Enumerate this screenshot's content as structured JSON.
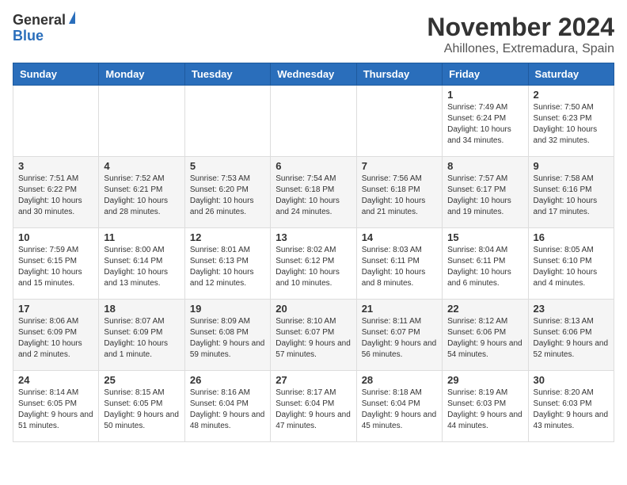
{
  "logo": {
    "general": "General",
    "blue": "Blue"
  },
  "header": {
    "month_title": "November 2024",
    "location": "Ahillones, Extremadura, Spain"
  },
  "weekdays": [
    "Sunday",
    "Monday",
    "Tuesday",
    "Wednesday",
    "Thursday",
    "Friday",
    "Saturday"
  ],
  "weeks": [
    [
      {
        "day": "",
        "info": ""
      },
      {
        "day": "",
        "info": ""
      },
      {
        "day": "",
        "info": ""
      },
      {
        "day": "",
        "info": ""
      },
      {
        "day": "",
        "info": ""
      },
      {
        "day": "1",
        "info": "Sunrise: 7:49 AM\nSunset: 6:24 PM\nDaylight: 10 hours and 34 minutes."
      },
      {
        "day": "2",
        "info": "Sunrise: 7:50 AM\nSunset: 6:23 PM\nDaylight: 10 hours and 32 minutes."
      }
    ],
    [
      {
        "day": "3",
        "info": "Sunrise: 7:51 AM\nSunset: 6:22 PM\nDaylight: 10 hours and 30 minutes."
      },
      {
        "day": "4",
        "info": "Sunrise: 7:52 AM\nSunset: 6:21 PM\nDaylight: 10 hours and 28 minutes."
      },
      {
        "day": "5",
        "info": "Sunrise: 7:53 AM\nSunset: 6:20 PM\nDaylight: 10 hours and 26 minutes."
      },
      {
        "day": "6",
        "info": "Sunrise: 7:54 AM\nSunset: 6:18 PM\nDaylight: 10 hours and 24 minutes."
      },
      {
        "day": "7",
        "info": "Sunrise: 7:56 AM\nSunset: 6:18 PM\nDaylight: 10 hours and 21 minutes."
      },
      {
        "day": "8",
        "info": "Sunrise: 7:57 AM\nSunset: 6:17 PM\nDaylight: 10 hours and 19 minutes."
      },
      {
        "day": "9",
        "info": "Sunrise: 7:58 AM\nSunset: 6:16 PM\nDaylight: 10 hours and 17 minutes."
      }
    ],
    [
      {
        "day": "10",
        "info": "Sunrise: 7:59 AM\nSunset: 6:15 PM\nDaylight: 10 hours and 15 minutes."
      },
      {
        "day": "11",
        "info": "Sunrise: 8:00 AM\nSunset: 6:14 PM\nDaylight: 10 hours and 13 minutes."
      },
      {
        "day": "12",
        "info": "Sunrise: 8:01 AM\nSunset: 6:13 PM\nDaylight: 10 hours and 12 minutes."
      },
      {
        "day": "13",
        "info": "Sunrise: 8:02 AM\nSunset: 6:12 PM\nDaylight: 10 hours and 10 minutes."
      },
      {
        "day": "14",
        "info": "Sunrise: 8:03 AM\nSunset: 6:11 PM\nDaylight: 10 hours and 8 minutes."
      },
      {
        "day": "15",
        "info": "Sunrise: 8:04 AM\nSunset: 6:11 PM\nDaylight: 10 hours and 6 minutes."
      },
      {
        "day": "16",
        "info": "Sunrise: 8:05 AM\nSunset: 6:10 PM\nDaylight: 10 hours and 4 minutes."
      }
    ],
    [
      {
        "day": "17",
        "info": "Sunrise: 8:06 AM\nSunset: 6:09 PM\nDaylight: 10 hours and 2 minutes."
      },
      {
        "day": "18",
        "info": "Sunrise: 8:07 AM\nSunset: 6:09 PM\nDaylight: 10 hours and 1 minute."
      },
      {
        "day": "19",
        "info": "Sunrise: 8:09 AM\nSunset: 6:08 PM\nDaylight: 9 hours and 59 minutes."
      },
      {
        "day": "20",
        "info": "Sunrise: 8:10 AM\nSunset: 6:07 PM\nDaylight: 9 hours and 57 minutes."
      },
      {
        "day": "21",
        "info": "Sunrise: 8:11 AM\nSunset: 6:07 PM\nDaylight: 9 hours and 56 minutes."
      },
      {
        "day": "22",
        "info": "Sunrise: 8:12 AM\nSunset: 6:06 PM\nDaylight: 9 hours and 54 minutes."
      },
      {
        "day": "23",
        "info": "Sunrise: 8:13 AM\nSunset: 6:06 PM\nDaylight: 9 hours and 52 minutes."
      }
    ],
    [
      {
        "day": "24",
        "info": "Sunrise: 8:14 AM\nSunset: 6:05 PM\nDaylight: 9 hours and 51 minutes."
      },
      {
        "day": "25",
        "info": "Sunrise: 8:15 AM\nSunset: 6:05 PM\nDaylight: 9 hours and 50 minutes."
      },
      {
        "day": "26",
        "info": "Sunrise: 8:16 AM\nSunset: 6:04 PM\nDaylight: 9 hours and 48 minutes."
      },
      {
        "day": "27",
        "info": "Sunrise: 8:17 AM\nSunset: 6:04 PM\nDaylight: 9 hours and 47 minutes."
      },
      {
        "day": "28",
        "info": "Sunrise: 8:18 AM\nSunset: 6:04 PM\nDaylight: 9 hours and 45 minutes."
      },
      {
        "day": "29",
        "info": "Sunrise: 8:19 AM\nSunset: 6:03 PM\nDaylight: 9 hours and 44 minutes."
      },
      {
        "day": "30",
        "info": "Sunrise: 8:20 AM\nSunset: 6:03 PM\nDaylight: 9 hours and 43 minutes."
      }
    ]
  ]
}
